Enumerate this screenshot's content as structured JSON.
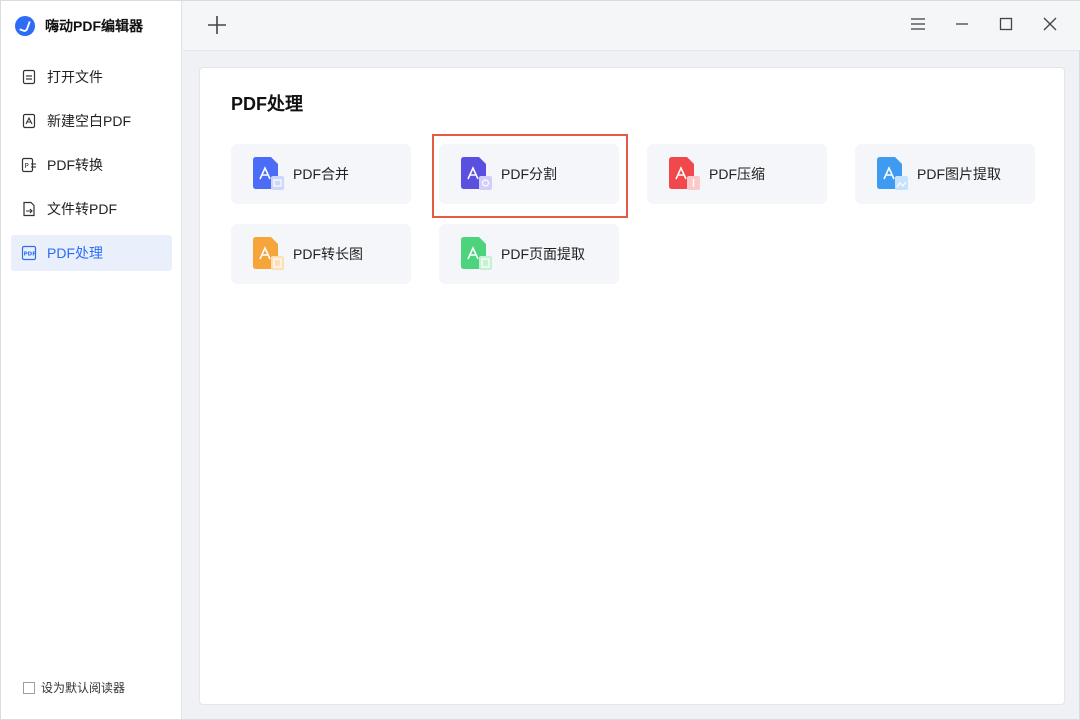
{
  "app": {
    "title": "嗨动PDF编辑器"
  },
  "sidebar": {
    "items": [
      {
        "label": "打开文件",
        "icon": "file-icon"
      },
      {
        "label": "新建空白PDF",
        "icon": "pdf-new-icon"
      },
      {
        "label": "PDF转换",
        "icon": "pdf-convert-icon"
      },
      {
        "label": "文件转PDF",
        "icon": "file-to-pdf-icon"
      },
      {
        "label": "PDF处理",
        "icon": "pdf-process-icon",
        "active": true
      }
    ],
    "default_reader_label": "设为默认阅读器"
  },
  "main": {
    "title": "PDF处理",
    "tools": [
      {
        "label": "PDF合并",
        "color": "#4a6cf7"
      },
      {
        "label": "PDF分割",
        "color": "#5b4fe0",
        "highlighted": true
      },
      {
        "label": "PDF压缩",
        "color": "#f0484b"
      },
      {
        "label": "PDF图片提取",
        "color": "#3f9bf2"
      },
      {
        "label": "PDF转长图",
        "color": "#f5a53a"
      },
      {
        "label": "PDF页面提取",
        "color": "#4cd37b"
      }
    ]
  },
  "colors": {
    "accent": "#2c6cf6",
    "highlight_border": "#e55a45"
  }
}
